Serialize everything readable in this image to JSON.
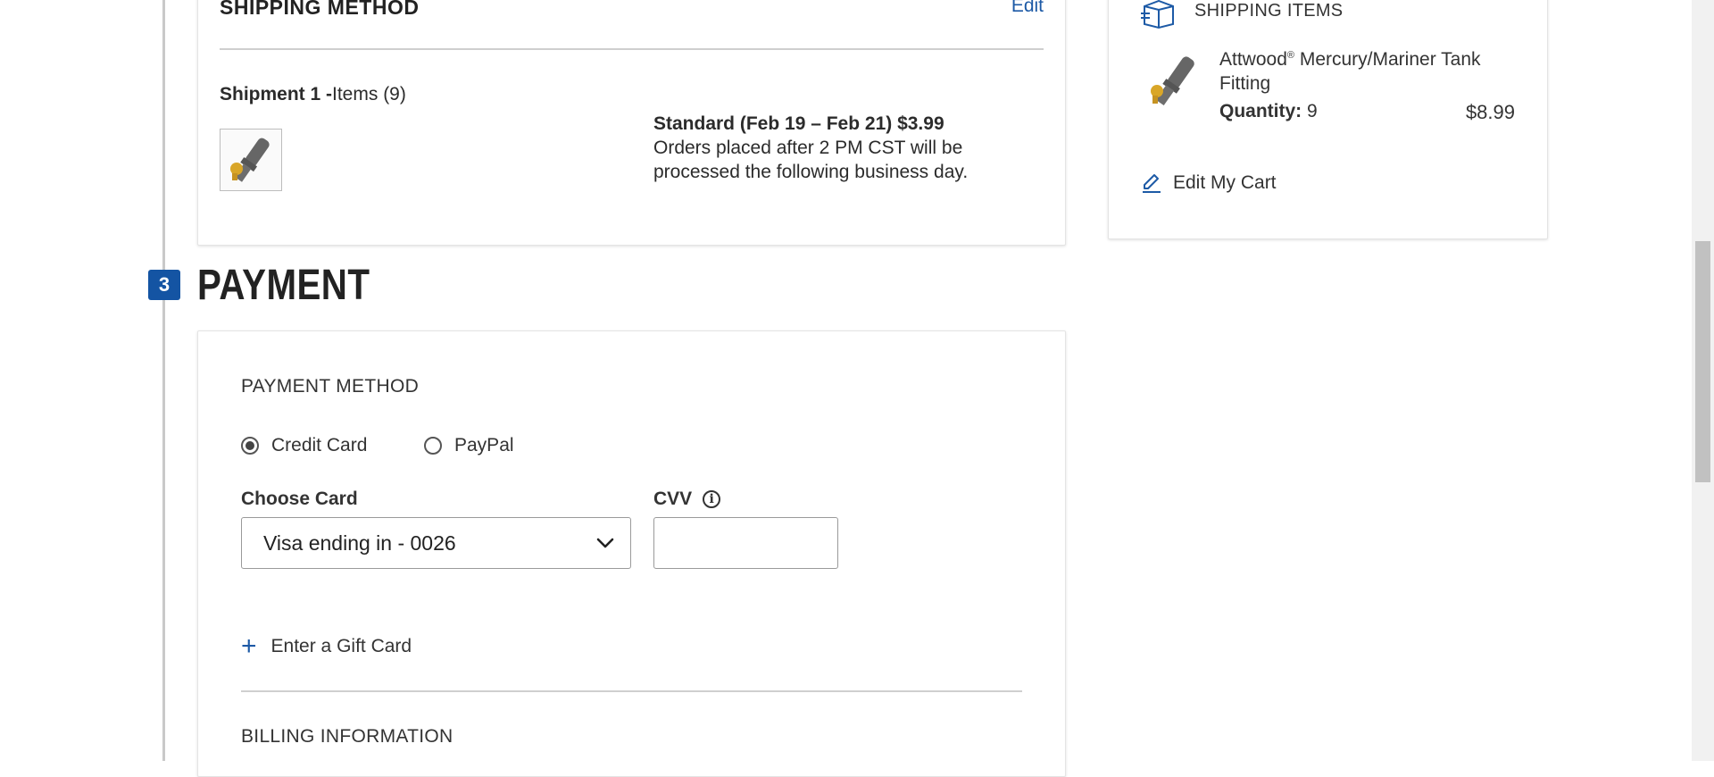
{
  "shipping": {
    "title": "SHIPPING METHOD",
    "edit_label": "Edit",
    "shipment_prefix": "Shipment 1 -",
    "shipment_items": "Items (9)",
    "option_title": "Standard (Feb 19 – Feb 21) $3.99",
    "option_note": "Orders placed after 2 PM CST will be processed the following business day."
  },
  "payment": {
    "step_number": "3",
    "section_title": "PAYMENT",
    "method_title": "PAYMENT METHOD",
    "options": [
      {
        "label": "Credit Card",
        "selected": true
      },
      {
        "label": "PayPal",
        "selected": false
      }
    ],
    "choose_card_label": "Choose Card",
    "card_selected": "Visa ending in - 0026",
    "cvv_label": "CVV",
    "cvv_value": "",
    "gift_card_label": "Enter a Gift Card",
    "billing_title": "BILLING INFORMATION"
  },
  "sidebar": {
    "title": "SHIPPING ITEMS",
    "item": {
      "name_part1": "Attwood",
      "name_mark": "®",
      "name_part2": " Mercury/Mariner Tank Fitting",
      "quantity_label": "Quantity:",
      "quantity_value": "9",
      "price": "$8.99"
    },
    "edit_cart_label": "Edit My Cart"
  },
  "colors": {
    "accent_blue": "#1454a3",
    "link_blue": "#1d5aa6",
    "text": "#2b2b2b",
    "border": "#e4e4e4"
  },
  "icons": [
    "shipping-box-icon",
    "pencil-icon",
    "chevron-down-icon",
    "info-icon",
    "plus-icon",
    "radio-icon"
  ]
}
